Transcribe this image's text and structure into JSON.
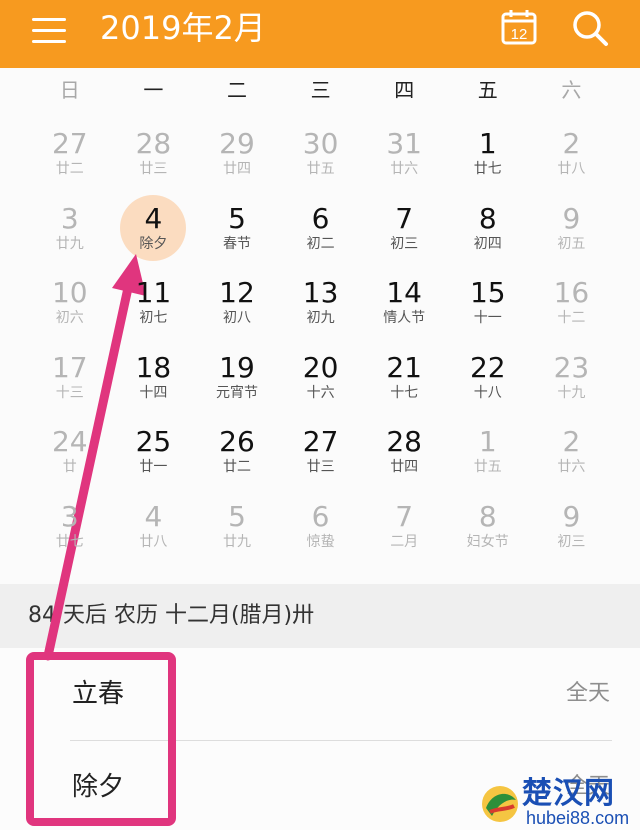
{
  "header": {
    "title": "2019年2月",
    "today_icon_day": "12"
  },
  "weekdays": [
    "日",
    "一",
    "二",
    "三",
    "四",
    "五",
    "六"
  ],
  "calendar": {
    "rows": [
      [
        {
          "day": "27",
          "lunar": "廿二",
          "dim": true
        },
        {
          "day": "28",
          "lunar": "廿三",
          "dim": true
        },
        {
          "day": "29",
          "lunar": "廿四",
          "dim": true
        },
        {
          "day": "30",
          "lunar": "廿五",
          "dim": true
        },
        {
          "day": "31",
          "lunar": "廿六",
          "dim": true
        },
        {
          "day": "1",
          "lunar": "廿七",
          "dim": false
        },
        {
          "day": "2",
          "lunar": "廿八",
          "dim": true
        }
      ],
      [
        {
          "day": "3",
          "lunar": "廿九",
          "dim": true
        },
        {
          "day": "4",
          "lunar": "除夕",
          "dim": false,
          "selected": true
        },
        {
          "day": "5",
          "lunar": "春节",
          "dim": false
        },
        {
          "day": "6",
          "lunar": "初二",
          "dim": false
        },
        {
          "day": "7",
          "lunar": "初三",
          "dim": false
        },
        {
          "day": "8",
          "lunar": "初四",
          "dim": false
        },
        {
          "day": "9",
          "lunar": "初五",
          "dim": true
        }
      ],
      [
        {
          "day": "10",
          "lunar": "初六",
          "dim": true
        },
        {
          "day": "11",
          "lunar": "初七",
          "dim": false
        },
        {
          "day": "12",
          "lunar": "初八",
          "dim": false
        },
        {
          "day": "13",
          "lunar": "初九",
          "dim": false
        },
        {
          "day": "14",
          "lunar": "情人节",
          "dim": false
        },
        {
          "day": "15",
          "lunar": "十一",
          "dim": false
        },
        {
          "day": "16",
          "lunar": "十二",
          "dim": true
        }
      ],
      [
        {
          "day": "17",
          "lunar": "十三",
          "dim": true
        },
        {
          "day": "18",
          "lunar": "十四",
          "dim": false
        },
        {
          "day": "19",
          "lunar": "元宵节",
          "dim": false
        },
        {
          "day": "20",
          "lunar": "十六",
          "dim": false
        },
        {
          "day": "21",
          "lunar": "十七",
          "dim": false
        },
        {
          "day": "22",
          "lunar": "十八",
          "dim": false
        },
        {
          "day": "23",
          "lunar": "十九",
          "dim": true
        }
      ],
      [
        {
          "day": "24",
          "lunar": "廿",
          "dim": true
        },
        {
          "day": "25",
          "lunar": "廿一",
          "dim": false
        },
        {
          "day": "26",
          "lunar": "廿二",
          "dim": false
        },
        {
          "day": "27",
          "lunar": "廿三",
          "dim": false
        },
        {
          "day": "28",
          "lunar": "廿四",
          "dim": false
        },
        {
          "day": "1",
          "lunar": "廿五",
          "dim": true
        },
        {
          "day": "2",
          "lunar": "廿六",
          "dim": true
        }
      ],
      [
        {
          "day": "3",
          "lunar": "廿七",
          "dim": true
        },
        {
          "day": "4",
          "lunar": "廿八",
          "dim": true
        },
        {
          "day": "5",
          "lunar": "廿九",
          "dim": true
        },
        {
          "day": "6",
          "lunar": "惊蛰",
          "dim": true
        },
        {
          "day": "7",
          "lunar": "二月",
          "dim": true
        },
        {
          "day": "8",
          "lunar": "妇女节",
          "dim": true
        },
        {
          "day": "9",
          "lunar": "初三",
          "dim": true
        }
      ]
    ]
  },
  "info": {
    "text": "84 天后  农历 十二月(腊月)卅"
  },
  "events": [
    {
      "name": "立春",
      "when": "全天"
    },
    {
      "name": "除夕",
      "when": "全天"
    }
  ],
  "watermark": {
    "text": "楚汉网",
    "url": "hubei88.com"
  },
  "colors": {
    "accent": "#f79a1f",
    "selected_circle": "#fbdcc0",
    "annotation": "#e0357e"
  }
}
